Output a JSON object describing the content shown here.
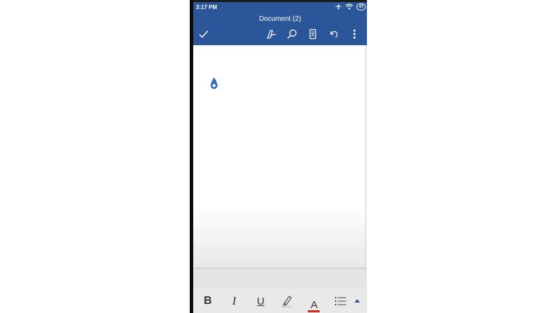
{
  "status_bar": {
    "time": "3:17 PM",
    "battery": "47",
    "icons": [
      "airplane-icon",
      "wifi-icon",
      "battery-icon"
    ]
  },
  "app_bar": {
    "title": "Document (2)",
    "accent_color": "#2b579a",
    "actions": [
      "done-check-icon",
      "draw-pen-icon",
      "search-icon",
      "mobile-view-icon",
      "undo-icon",
      "more-options-icon"
    ]
  },
  "document": {
    "text": ""
  },
  "format_toolbar": {
    "bold_label": "B",
    "italic_label": "I",
    "underline_label": "U",
    "font_color_label": "A",
    "font_color": "#d42b1e",
    "extra_icons": [
      "highlighter-icon",
      "bullet-list-icon",
      "expand-up-icon"
    ]
  }
}
